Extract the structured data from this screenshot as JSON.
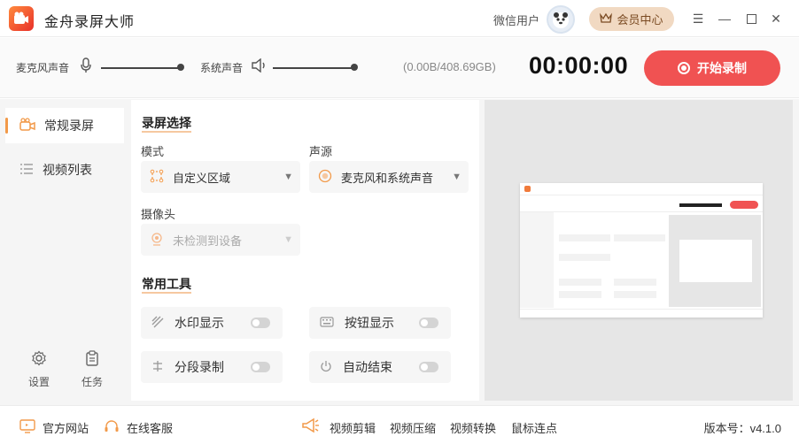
{
  "app": {
    "title": "金舟录屏大师"
  },
  "user": {
    "name": "微信用户",
    "vip_label": "会员中心"
  },
  "audio": {
    "mic_label": "麦克风声音",
    "system_label": "系统声音",
    "mic_level": 1.0,
    "system_level": 1.0,
    "storage": "(0.00B/408.69GB)",
    "timer": "00:00:00",
    "start_label": "开始录制"
  },
  "sidebar": {
    "items": [
      {
        "label": "常规录屏",
        "icon": "camera-icon",
        "active": true
      },
      {
        "label": "视频列表",
        "icon": "list-icon",
        "active": false
      }
    ],
    "settings_label": "设置",
    "tasks_label": "任务"
  },
  "panel": {
    "screen_section": "录屏选择",
    "mode_label": "模式",
    "mode_value": "自定义区域",
    "audio_label": "声源",
    "audio_value": "麦克风和系统声音",
    "camera_label": "摄像头",
    "camera_value": "未检测到设备",
    "tools_section": "常用工具",
    "tools": [
      {
        "label": "水印显示",
        "icon": "watermark-icon",
        "on": false
      },
      {
        "label": "按钮显示",
        "icon": "keyboard-icon",
        "on": false
      },
      {
        "label": "分段录制",
        "icon": "segment-icon",
        "on": false
      },
      {
        "label": "自动结束",
        "icon": "power-icon",
        "on": false
      }
    ]
  },
  "footer": {
    "website": "官方网站",
    "support": "在线客服",
    "links": [
      "视频剪辑",
      "视频压缩",
      "视频转换",
      "鼠标连点"
    ],
    "version": "版本号：v4.1.0"
  },
  "colors": {
    "accent": "#f05252",
    "orange": "#f29a4a",
    "vip_bg": "#f1d9c2"
  }
}
